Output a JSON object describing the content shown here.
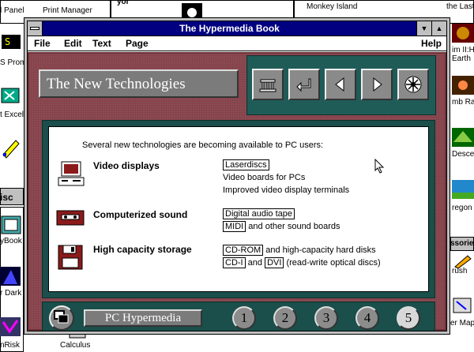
{
  "desktop": {
    "labels": {
      "panel": "l Panel",
      "print_manager": "Print Manager",
      "monkey_island": "Monkey Island",
      "the_last": "the Last Cr",
      "prompt": "S Promp",
      "excel": "t Excel",
      "book": "yBook",
      "dark": "r Dark",
      "risk": "nRisk",
      "calculus": "Calculus",
      "earth": "im II:H Earth",
      "tomb": "mb Ra",
      "desce": "Desce",
      "regon": "regon",
      "misc": "isc",
      "sories": "ssories",
      "brush": "rush",
      "map": "er Map",
      "yor": "yor"
    }
  },
  "window": {
    "title": "The Hypermedia Book",
    "menu": {
      "file": "File",
      "edit": "Edit",
      "text": "Text",
      "page": "Page",
      "help": "Help"
    }
  },
  "book": {
    "heading": "The New Technologies",
    "intro": "Several new technologies are becoming available to PC users:",
    "sections": [
      {
        "title": "Video displays",
        "lines": [
          {
            "boxed": "Laserdiscs",
            "rest": ""
          },
          {
            "boxed": "",
            "rest": "Video boards for PCs"
          },
          {
            "boxed": "",
            "rest": "Improved video display terminals"
          }
        ]
      },
      {
        "title": "Computerized sound",
        "lines": [
          {
            "boxed": "Digital audio tape",
            "rest": ""
          },
          {
            "boxed": "MIDI",
            "rest": " and other sound boards"
          }
        ]
      },
      {
        "title": "High capacity storage",
        "lines": [
          {
            "boxed": "CD-ROM",
            "rest": " and high-capacity hard disks"
          },
          {
            "boxed": "CD-I",
            "boxed2": "DVI",
            "mid": " and ",
            "rest": " (read-write optical discs)"
          }
        ]
      }
    ],
    "footer_title": "PC Hypermedia",
    "chapters": [
      "1",
      "2",
      "3",
      "4",
      "5"
    ],
    "active_chapter": "5"
  }
}
